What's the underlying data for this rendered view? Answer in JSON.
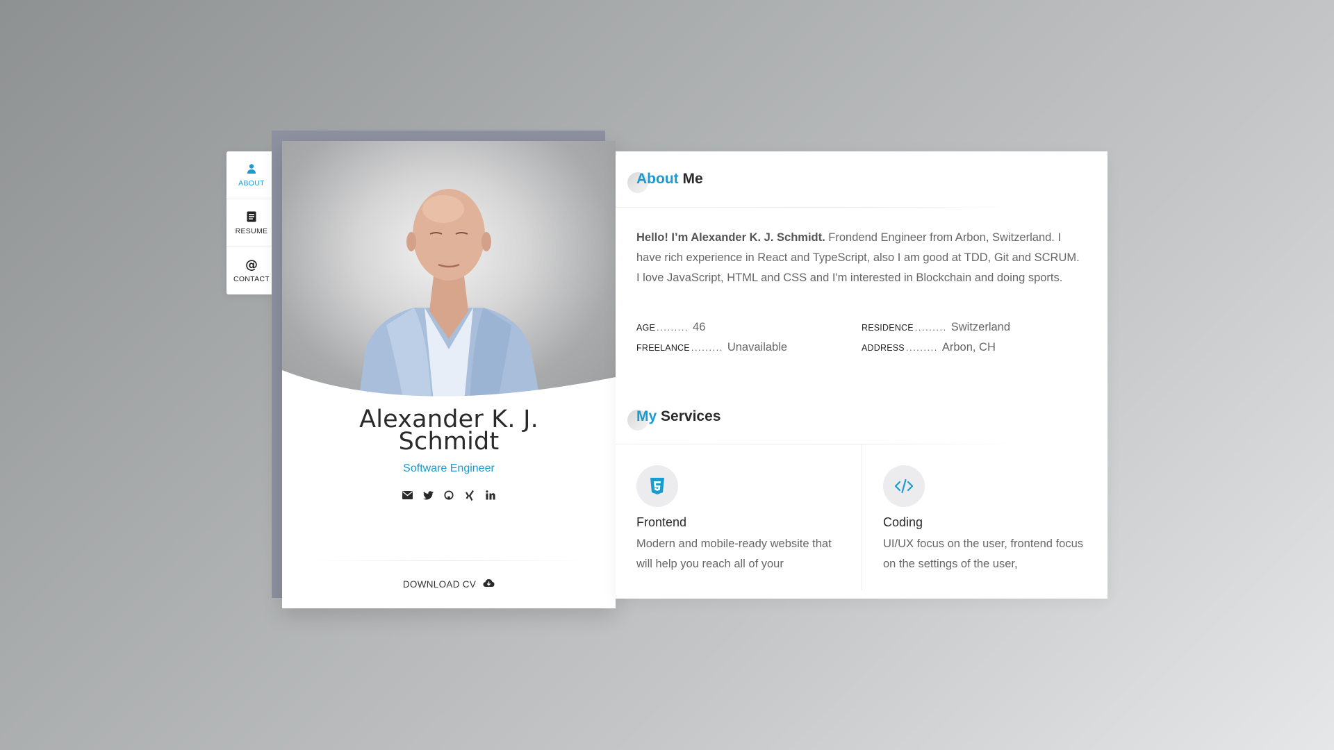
{
  "nav": {
    "items": [
      {
        "label": "ABOUT",
        "icon": "user-icon",
        "active": true
      },
      {
        "label": "RESUME",
        "icon": "document-icon",
        "active": false
      },
      {
        "label": "CONTACT",
        "icon": "at-icon",
        "active": false
      }
    ]
  },
  "profile": {
    "name_line1": "Alexander K. J.",
    "name_line2": "Schmidt",
    "role": "Software Engineer",
    "social": [
      "email-icon",
      "twitter-icon",
      "github-icon",
      "xing-icon",
      "linkedin-icon"
    ],
    "download_label": "DOWNLOAD CV"
  },
  "about": {
    "title_accent": "About",
    "title_rest": "Me",
    "intro_bold": "Hello! I’m Alexander K. J. Schmidt.",
    "intro_text": " Frondend Engineer from Arbon, Switzerland. I have rich experience in React and TypeScript, also I am good at TDD, Git and SCRUM. I love JavaScript, HTML and CSS and I'm interested in Blockchain and doing sports.",
    "info": [
      {
        "label": "AGE",
        "value": "46"
      },
      {
        "label": "RESIDENCE",
        "value": "Switzerland"
      },
      {
        "label": "FREELANCE",
        "value": "Unavailable"
      },
      {
        "label": "ADDRESS",
        "value": "Arbon, CH"
      }
    ],
    "dots": "........."
  },
  "services": {
    "title_accent": "My",
    "title_rest": "Services",
    "items": [
      {
        "title": "Frontend",
        "icon": "html5-icon",
        "desc": "Modern and mobile-ready website that will help you reach all of your"
      },
      {
        "title": "Coding",
        "icon": "code-icon",
        "desc": "UI/UX focus on the user, frontend focus on the settings of the user,"
      }
    ]
  },
  "colors": {
    "accent": "#1a9bd0",
    "text": "#2a2a2a",
    "muted": "#666666",
    "backdrop": "#8e91a0"
  }
}
